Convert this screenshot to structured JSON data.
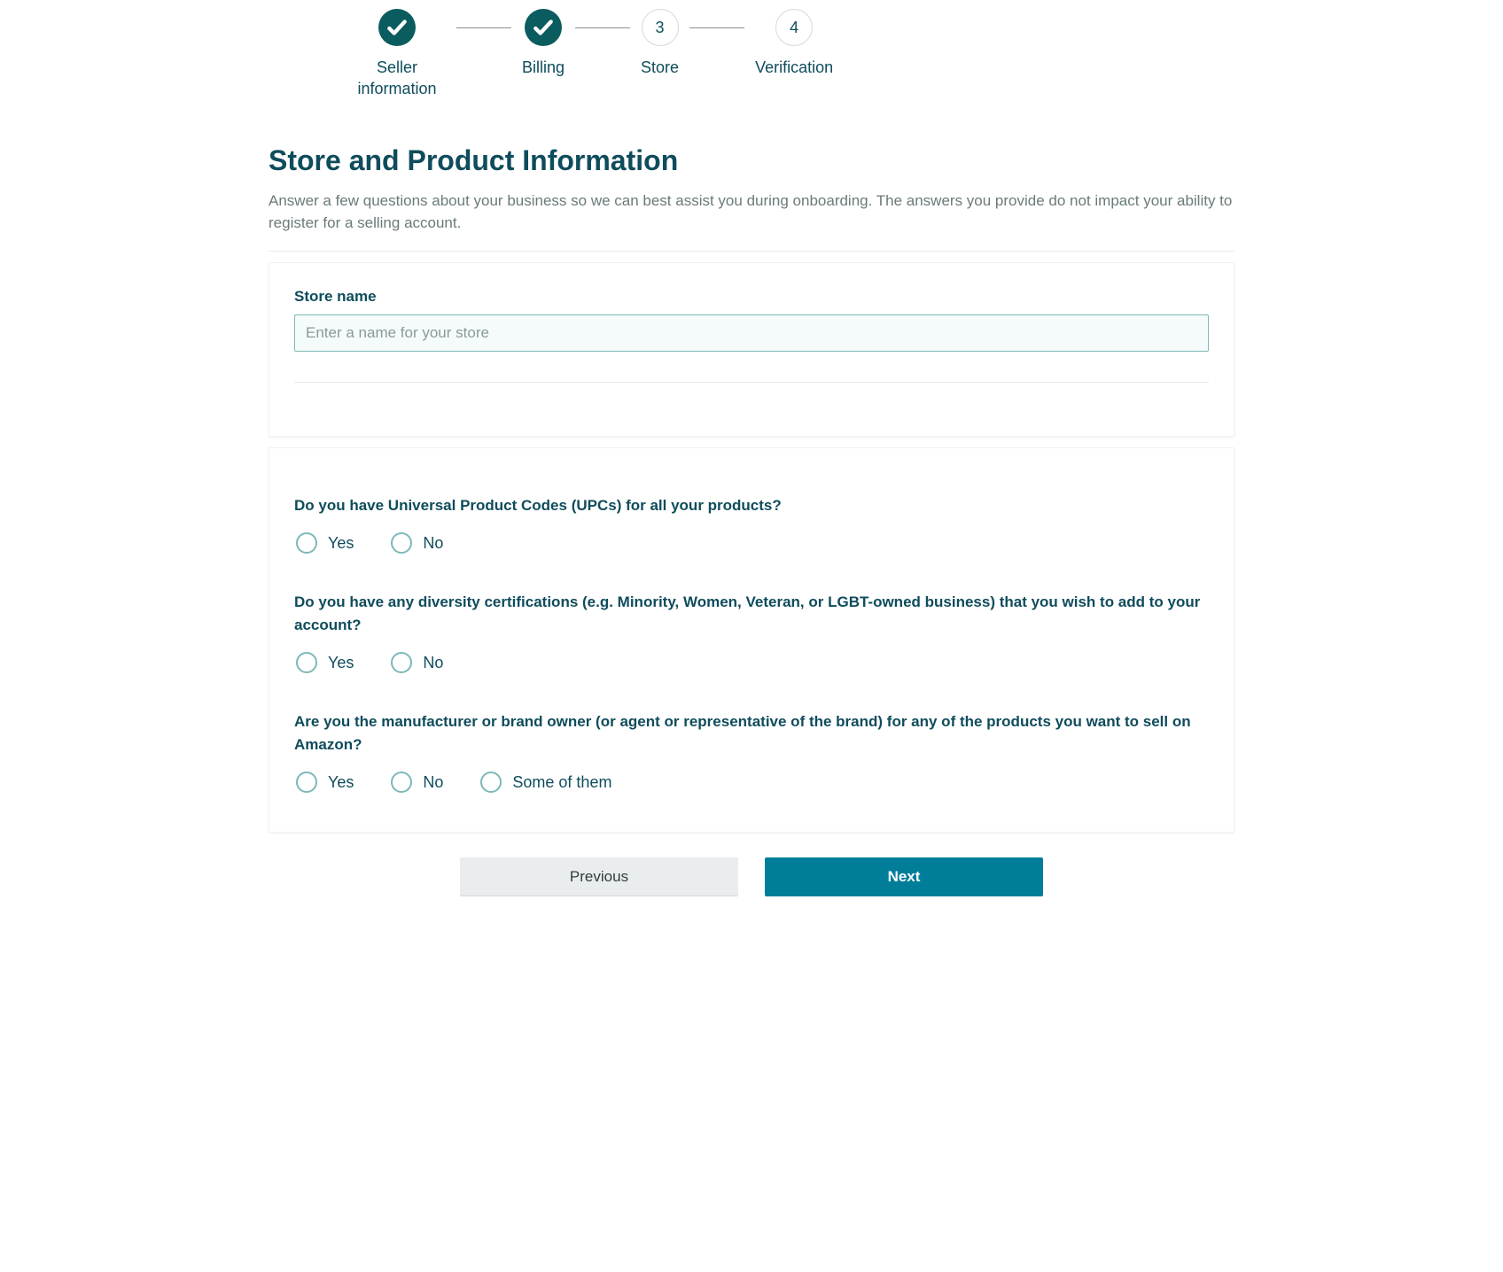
{
  "stepper": {
    "steps": [
      {
        "label": "Seller information",
        "state": "completed"
      },
      {
        "label": "Billing",
        "state": "completed"
      },
      {
        "label": "Store",
        "state": "pending",
        "number": "3"
      },
      {
        "label": "Verification",
        "state": "pending",
        "number": "4"
      }
    ]
  },
  "header": {
    "title": "Store and Product Information",
    "description": "Answer a few questions about your business so we can best assist you during onboarding. The answers you provide do not impact your ability to register for a selling account."
  },
  "store": {
    "label": "Store name",
    "placeholder": "Enter a name for your store",
    "value": ""
  },
  "questions": {
    "upc": {
      "label": "Do you have Universal Product Codes (UPCs) for all your products?",
      "options": {
        "yes": "Yes",
        "no": "No"
      }
    },
    "diversity": {
      "label": "Do you have any diversity certifications (e.g. Minority, Women, Veteran, or LGBT-owned business) that you wish to add to your account?",
      "options": {
        "yes": "Yes",
        "no": "No"
      }
    },
    "manufacturer": {
      "label": "Are you the manufacturer or brand owner (or agent or representative of the brand) for any of the products you want to sell on Amazon?",
      "options": {
        "yes": "Yes",
        "no": "No",
        "some": "Some of them"
      }
    }
  },
  "buttons": {
    "previous": "Previous",
    "next": "Next"
  }
}
